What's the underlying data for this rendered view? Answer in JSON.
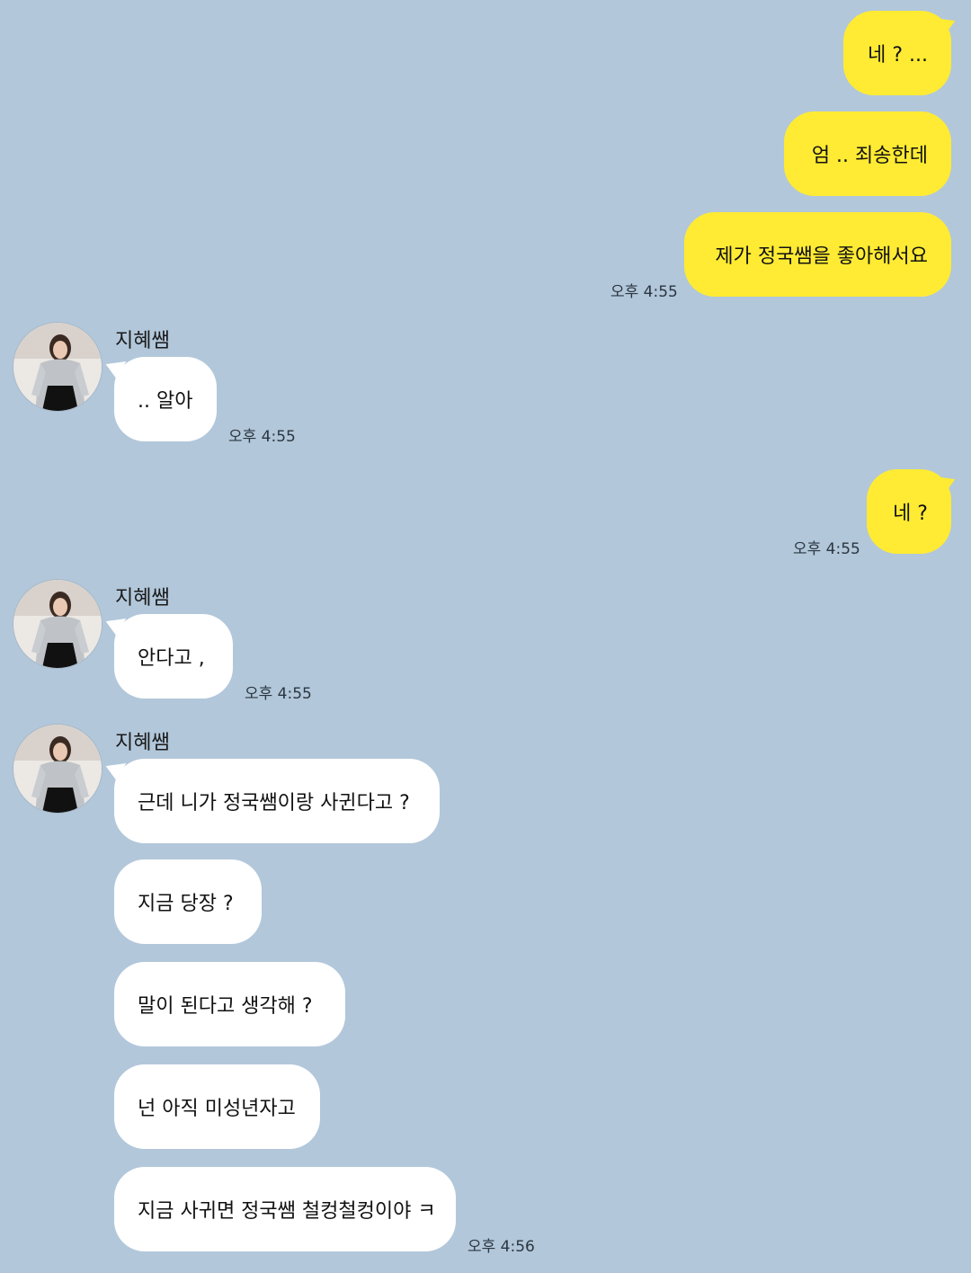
{
  "theme": {
    "background": "#b2c7da",
    "my_bubble": "#ffeb33",
    "their_bubble": "#ffffff"
  },
  "sender": {
    "name": "지혜쌤",
    "avatar_icon": "profile-photo-avatar"
  },
  "messages": {
    "m1": "네 ? ...",
    "m2": "엄 .. 죄송한데",
    "m3": "제가 정국쌤을 좋아해서요",
    "m3_time": "오후 4:55",
    "m4": ".. 알아",
    "m4_time": "오후 4:55",
    "m5": "네 ?",
    "m5_time": "오후 4:55",
    "m6": "안다고 ,",
    "m6_time": "오후 4:55",
    "m7": "근데 니가 정국쌤이랑 사귄다고 ?",
    "m8": "지금 당장 ?",
    "m9": "말이 된다고 생각해 ?",
    "m10": "넌 아직 미성년자고",
    "m11": "지금 사귀면 정국쌤 철컹철컹이야 ㅋ",
    "m11_time": "오후 4:56"
  }
}
